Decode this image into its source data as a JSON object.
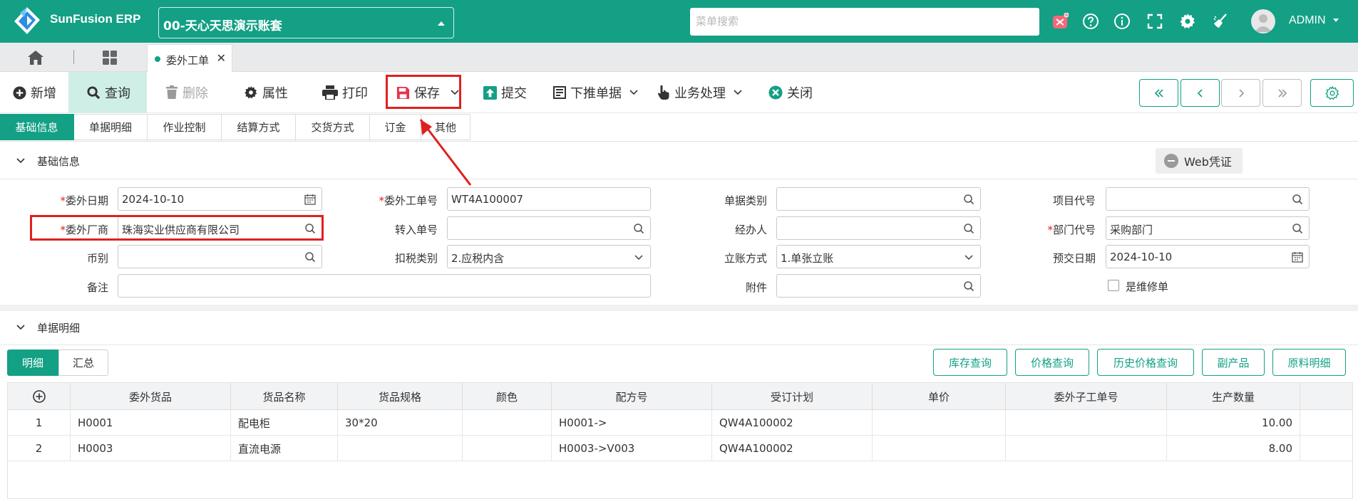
{
  "app": {
    "brand": "SunFusion ERP",
    "account": "00-天心天思演示账套",
    "search_placeholder": "菜单搜索",
    "user": "ADMIN"
  },
  "tabs": {
    "open_tab": "委外工单"
  },
  "toolbar": {
    "new": "新增",
    "query": "查询",
    "delete": "删除",
    "properties": "属性",
    "print": "打印",
    "save": "保存",
    "submit": "提交",
    "push_down": "下推单据",
    "business": "业务处理",
    "close": "关闭"
  },
  "section_tabs": [
    "基础信息",
    "单据明细",
    "作业控制",
    "结算方式",
    "交货方式",
    "订金",
    "其他"
  ],
  "basic": {
    "title": "基础信息",
    "web_voucher": "Web凭证",
    "labels": {
      "outsource_date": "委外日期",
      "outsource_order_no": "委外工单号",
      "doc_type": "单据类别",
      "project_code": "项目代号",
      "vendor": "委外厂商",
      "transfer_no": "转入单号",
      "handler": "经办人",
      "dept_code": "部门代号",
      "currency": "币别",
      "tax_type": "扣税类别",
      "account_method": "立账方式",
      "pre_delivery_date": "预交日期",
      "remark": "备注",
      "attachment": "附件",
      "is_repair": "是维修单"
    },
    "values": {
      "outsource_date": "2024-10-10",
      "outsource_order_no": "WT4A100007",
      "doc_type": "",
      "project_code": "",
      "vendor": "珠海实业供应商有限公司",
      "transfer_no": "",
      "handler": "",
      "dept_code": "采购部门",
      "currency": "",
      "tax_type": "2.应税内含",
      "account_method": "1.单张立账",
      "pre_delivery_date": "2024-10-10",
      "remark": "",
      "attachment": ""
    }
  },
  "detail": {
    "title": "单据明细",
    "tabs": [
      "明细",
      "汇总"
    ],
    "buttons": [
      "库存查询",
      "价格查询",
      "历史价格查询",
      "副产品",
      "原料明细"
    ],
    "columns": [
      "委外货品",
      "货品名称",
      "货品规格",
      "颜色",
      "配方号",
      "受订计划",
      "单价",
      "委外子工单号",
      "生产数量"
    ],
    "rows": [
      {
        "no": "1",
        "item": "H0001",
        "name": "配电柜",
        "spec": "30*20",
        "color": "",
        "formula": "H0001->",
        "plan": "QW4A100002",
        "price": "",
        "sub_order": "",
        "qty": "10.00"
      },
      {
        "no": "2",
        "item": "H0003",
        "name": "直流电源",
        "spec": "",
        "color": "",
        "formula": "H0003->V003",
        "plan": "QW4A100002",
        "price": "",
        "sub_order": "",
        "qty": "8.00"
      }
    ]
  },
  "colors": {
    "brand": "#13a085",
    "highlight": "#e02020",
    "active_bg": "#cfeee6"
  }
}
